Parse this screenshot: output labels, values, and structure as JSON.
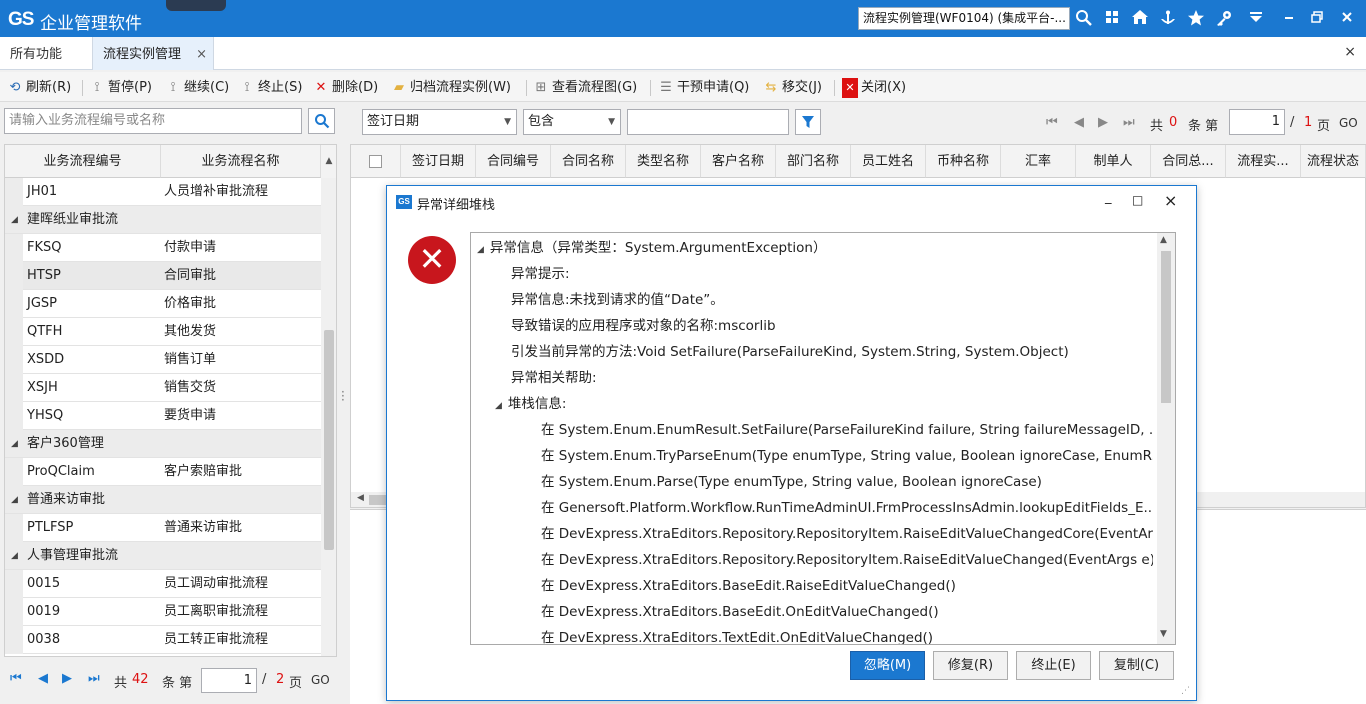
{
  "app": {
    "logo": "GS",
    "title": "企业管理软件",
    "search_value": "流程实例管理(WF0104) (集成平台-..."
  },
  "top_icons": [
    "search-icon",
    "grid-icon",
    "home-icon",
    "anchor-icon",
    "star-icon",
    "key-icon",
    "menu-down-icon",
    "minimize-icon",
    "restore-icon",
    "close-icon"
  ],
  "tabs": [
    {
      "label": "所有功能"
    },
    {
      "label": "流程实例管理",
      "close": "×"
    }
  ],
  "window_close": "×",
  "toolbar": {
    "refresh": "刷新(R)",
    "pause": "暂停(P)",
    "resume": "继续(C)",
    "stop": "终止(S)",
    "delete": "删除(D)",
    "archive": "归档流程实例(W)",
    "view_chart": "查看流程图(G)",
    "intervene": "干预申请(Q)",
    "transfer": "移交(J)",
    "close": "关闭(X)"
  },
  "left": {
    "search_placeholder": "请输入业务流程编号或名称",
    "headers": [
      "业务流程编号",
      "业务流程名称"
    ],
    "rows": [
      {
        "code": "JH01",
        "name": "人员增补审批流程"
      },
      {
        "group": "建晖纸业审批流"
      },
      {
        "code": "FKSQ",
        "name": "付款申请"
      },
      {
        "code": "HTSP",
        "name": "合同审批"
      },
      {
        "code": "JGSP",
        "name": "价格审批"
      },
      {
        "code": "QTFH",
        "name": "其他发货"
      },
      {
        "code": "XSDD",
        "name": "销售订单"
      },
      {
        "code": "XSJH",
        "name": "销售交货"
      },
      {
        "code": "YHSQ",
        "name": "要货申请"
      },
      {
        "group": "客户360管理"
      },
      {
        "code": "ProQClaim",
        "name": "客户索赔审批"
      },
      {
        "group": "普通来访审批"
      },
      {
        "code": "PTLFSP",
        "name": "普通来访审批"
      },
      {
        "group": "人事管理审批流"
      },
      {
        "code": "0015",
        "name": "员工调动审批流程"
      },
      {
        "code": "0019",
        "name": "员工离职审批流程"
      },
      {
        "code": "0038",
        "name": "员工转正审批流程"
      }
    ],
    "pager": {
      "total_prefix": "共",
      "total": "42",
      "total_suffix": "条 第",
      "page": "1",
      "slash": "/",
      "pages": "2",
      "pages_suffix": "页",
      "go": "GO"
    }
  },
  "filter": {
    "field": "签订日期",
    "op": "包含",
    "value": ""
  },
  "right": {
    "pager": {
      "total_prefix": "共",
      "total": "0",
      "total_suffix": "条 第",
      "page": "1",
      "slash": "/",
      "pages": "1",
      "pages_suffix": "页",
      "go": "GO"
    },
    "headers": [
      "签订日期",
      "合同编号",
      "合同名称",
      "类型名称",
      "客户名称",
      "部门名称",
      "员工姓名",
      "币种名称",
      "汇率",
      "制单人",
      "合同总...",
      "流程实...",
      "流程状态"
    ]
  },
  "dialog": {
    "logo": "GS",
    "title": "异常详细堆栈",
    "controls": {
      "min": "_",
      "max": "□",
      "close": "×"
    },
    "error_glyph": "✕",
    "lines": [
      {
        "level": 0,
        "tri": "◢",
        "text": "异常信息（异常类型：System.ArgumentException）"
      },
      {
        "level": 1,
        "text": "异常提示:"
      },
      {
        "level": 1,
        "text": "异常信息:未找到请求的值“Date”。"
      },
      {
        "level": 1,
        "text": "导致错误的应用程序或对象的名称:mscorlib"
      },
      {
        "level": 1,
        "text": "引发当前异常的方法:Void SetFailure(ParseFailureKind, System.String, System.Object)"
      },
      {
        "level": 1,
        "text": "异常相关帮助:"
      },
      {
        "level": 1,
        "tri": "◢",
        "text": "堆栈信息:"
      },
      {
        "level": 2,
        "text": "在 System.Enum.EnumResult.SetFailure(ParseFailureKind failure, String failureMessageID, ..."
      },
      {
        "level": 2,
        "text": "在 System.Enum.TryParseEnum(Type enumType, String value, Boolean ignoreCase, EnumR..."
      },
      {
        "level": 2,
        "text": "在 System.Enum.Parse(Type enumType, String value, Boolean ignoreCase)"
      },
      {
        "level": 2,
        "text": "在 Genersoft.Platform.Workflow.RunTimeAdminUI.FrmProcessInsAdmin.lookupEditFields_E..."
      },
      {
        "level": 2,
        "text": "在 DevExpress.XtraEditors.Repository.RepositoryItem.RaiseEditValueChangedCore(EventAr..."
      },
      {
        "level": 2,
        "text": "在 DevExpress.XtraEditors.Repository.RepositoryItem.RaiseEditValueChanged(EventArgs e)"
      },
      {
        "level": 2,
        "text": "在 DevExpress.XtraEditors.BaseEdit.RaiseEditValueChanged()"
      },
      {
        "level": 2,
        "text": "在 DevExpress.XtraEditors.BaseEdit.OnEditValueChanged()"
      },
      {
        "level": 2,
        "text": "在 DevExpress.XtraEditors.TextEdit.OnEditValueChanged()"
      }
    ],
    "buttons": {
      "ignore": "忽略(M)",
      "repair": "修复(R)",
      "terminate": "终止(E)",
      "copy": "复制(C)"
    }
  }
}
